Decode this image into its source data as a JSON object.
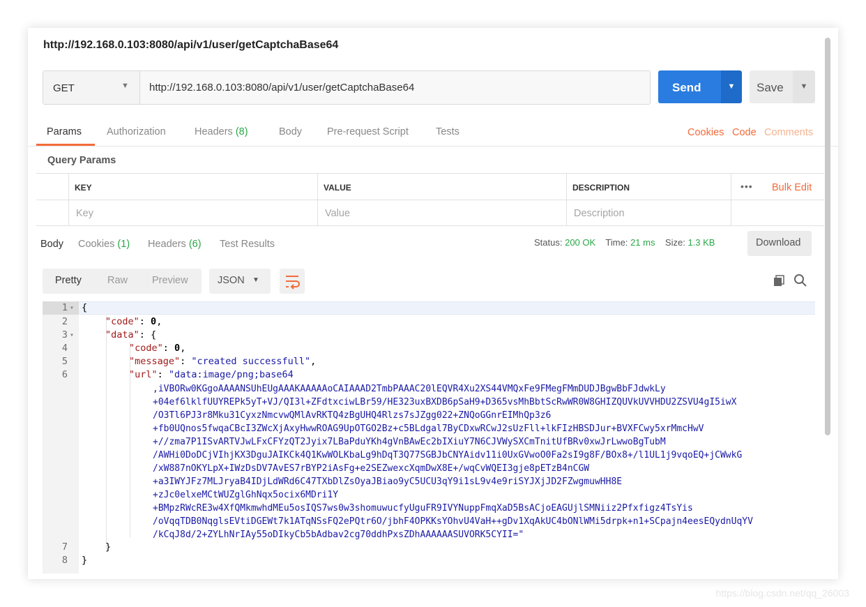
{
  "window": {
    "title": "http://192.168.0.103:8080/api/v1/user/getCaptchaBase64"
  },
  "request": {
    "method": "GET",
    "url": "http://192.168.0.103:8080/api/v1/user/getCaptchaBase64",
    "send_label": "Send",
    "save_label": "Save"
  },
  "request_tabs": {
    "params": "Params",
    "authorization": "Authorization",
    "headers": "Headers",
    "headers_count": "(8)",
    "body": "Body",
    "prerequest": "Pre-request Script",
    "tests": "Tests"
  },
  "right_links": {
    "cookies": "Cookies",
    "code": "Code",
    "comments": "Comments"
  },
  "query_params": {
    "title": "Query Params",
    "columns": [
      "KEY",
      "VALUE",
      "DESCRIPTION"
    ],
    "placeholders": [
      "Key",
      "Value",
      "Description"
    ],
    "more": "•••",
    "bulk_edit": "Bulk Edit"
  },
  "response_tabs": {
    "body": "Body",
    "cookies": "Cookies",
    "cookies_count": "(1)",
    "headers": "Headers",
    "headers_count": "(6)",
    "test_results": "Test Results"
  },
  "status": {
    "status_label": "Status:",
    "status_value": "200 OK",
    "time_label": "Time:",
    "time_value": "21 ms",
    "size_label": "Size:",
    "size_value": "1.3 KB",
    "download_label": "Download"
  },
  "view_toolbar": {
    "pretty": "Pretty",
    "raw": "Raw",
    "preview": "Preview",
    "format": "JSON"
  },
  "icons": {
    "wrap": "wrap-lines-icon",
    "copy": "copy-icon",
    "search": "search-icon"
  },
  "colors": {
    "accent": "#f26b3a",
    "send": "#2a7ce0",
    "ok": "#29a746",
    "json_key": "#a11a1a",
    "json_string": "#1a1aa6"
  },
  "body": {
    "line_numbers": [
      "1",
      "2",
      "3",
      "4",
      "5",
      "6",
      "7",
      "8"
    ],
    "lines": {
      "l1": "{",
      "l2_key": "\"code\"",
      "l2_rest": ": ",
      "l2_val": "0",
      "l2_end": ",",
      "l3_key": "\"data\"",
      "l3_rest": ": {",
      "l4_key": "\"code\"",
      "l4_rest": ": ",
      "l4_val": "0",
      "l4_end": ",",
      "l5_key": "\"message\"",
      "l5_rest": ": ",
      "l5_val": "\"created successfull\"",
      "l5_end": ",",
      "l6_key": "\"url\"",
      "l6_rest": ": ",
      "l6_val": "\"data:image/png;base64",
      "l7": "}",
      "l8": "}"
    },
    "url_continuation": [
      ",iVBORw0KGgoAAAANSUhEUgAAAKAAAAAoCAIAAAD2TmbPAAAC20lEQVR4Xu2XS44VMQxFe9FMegFMmDUDJBgwBbFJdwkLy",
      "+04ef6lklfUUYREPk5yT+VJ/QI3l+ZFdtxciwLBr59/HE323uxBXDB6pSaH9+D365vsMhBbtScRwWR0W8GHIZQUVkUVVHDU2ZSVU4gI5iwX",
      "/O3Tl6PJ3r8Mku31CyxzNmcvwQMlAvRKTQ4zBgUHQ4Rlzs7sJZgg022+ZNQoGGnrEIMhQp3z6",
      "+fb0UQnos5fwqaCBcI3ZWcXjAxyHwwROAG9UpOTGO2Bz+c5BLdgal7ByCDxwRCwJ2sUzFll+lkFIzHBSDJur+BVXFCwy5xrMmcHwV",
      "+//zma7P1ISvARTVJwLFxCFYzQT2Jyix7LBaPduYKh4gVnBAwEc2bIXiuY7N6CJVWySXCmTnitUfBRv0xwJrLwwoBgTubM",
      "/AWHi0DoDCjVIhjKX3DguJAIKCk4Q1KwWOLKbaLg9hDqT3Q77SGBJbCNYAidv11i0UxGVwoO0Fa2sI9g8F/BOx8+/l1UL1j9vqoEQ+jCWwkG",
      "/xW887nOKYLpX+IWzDsDV7AvES7rBYP2iAsFg+e2SEZwexcXqmDwX8E+/wqCvWQEI3gje8pETzB4nCGW",
      "+a3IWYJFz7MLJryaB4IDjLdWRd6C47TXbDlZsOyaJBiao9yC5UCU3qY9i1sL9v4e9riSYJXjJD2FZwgmuwHH8E",
      "+zJc0elxeMCtWUZglGhNqx5ocix6MDri1Y",
      "+BMpzRWcRE3w4XfQMkmwhdMEu5osIQS7ws0w3shomuwucfyUguFR9IVYNuppFmqXaD5BsACjoEAGUjlSMNiiz2Pfxfigz4TsYis",
      "/oVqqTDB0NqglsEVtiDGEWt7k1ATqNSsFQ2ePQtr6O/jbhF4OPKKsYOhvU4VaH++gDv1XqAkUC4bONlWMi5drpk+n1+SCpajn4eesEQydnUqYV",
      "/kCqJ8d/2+ZYLhNrIAy55oDIkyCb5bAdbav2cg70ddhPxsZDhAAAAAASUVORK5CYII=\""
    ]
  },
  "watermark": "https://blog.csdn.net/qq_26003"
}
